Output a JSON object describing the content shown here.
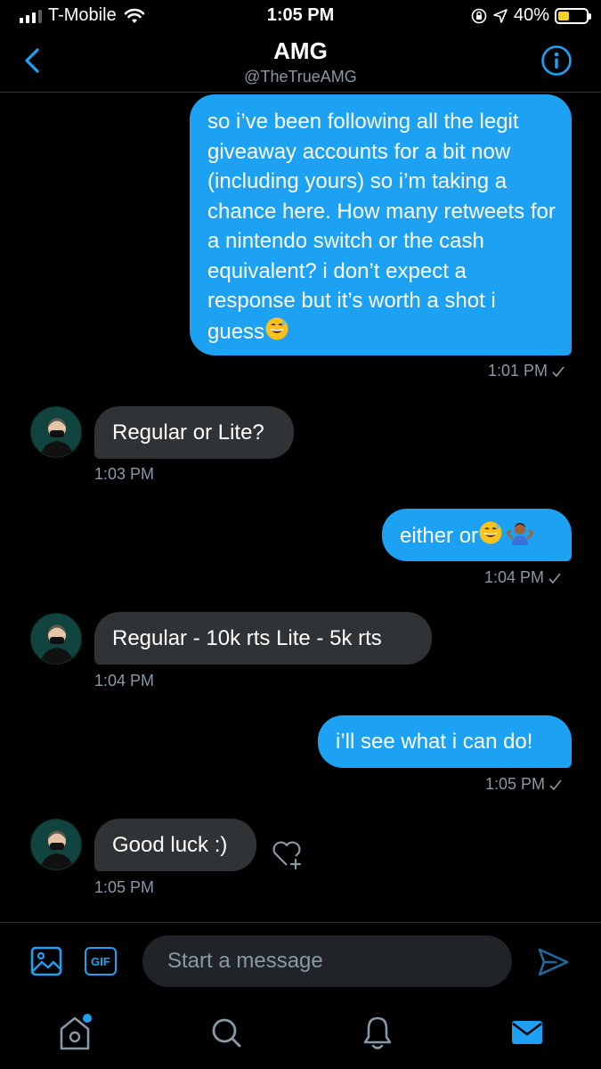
{
  "status_bar": {
    "carrier": "T-Mobile",
    "time": "1:05 PM",
    "battery": "40%",
    "battery_level": 0.4
  },
  "header": {
    "title": "AMG",
    "handle": "@TheTrueAMG"
  },
  "messages": [
    {
      "direction": "outgoing",
      "text": "so i’ve been following all the legit giveaway accounts for a bit now (including yours) so i’m taking a chance here. How many retweets for a nintendo switch or the cash equivalent? i don’t expect a response but it’s worth a shot i guess",
      "emoji": [
        "sweat-smile"
      ],
      "time": "1:01 PM"
    },
    {
      "direction": "incoming",
      "text": "Regular or Lite?",
      "time": "1:03 PM"
    },
    {
      "direction": "outgoing",
      "text": "either or",
      "emoji": [
        "sweat-smile",
        "person-shrugging"
      ],
      "time": "1:04 PM"
    },
    {
      "direction": "incoming",
      "text": "Regular - 10k rts Lite - 5k rts",
      "time": "1:04 PM"
    },
    {
      "direction": "outgoing",
      "text": "i’ll see what i can do!",
      "time": "1:05 PM"
    },
    {
      "direction": "incoming",
      "text": "Good luck :)",
      "time": "1:05 PM"
    }
  ],
  "composer": {
    "gif_label": "GIF",
    "placeholder": "Start a message"
  },
  "tab_bar": {
    "items": [
      "home-icon",
      "search-icon",
      "notifications-icon",
      "messages-icon"
    ],
    "active": "messages-icon"
  },
  "colors": {
    "accent": "#1da1f2",
    "incoming_bubble": "#2f3336",
    "background": "#000000",
    "secondary_text": "#8899a6"
  }
}
